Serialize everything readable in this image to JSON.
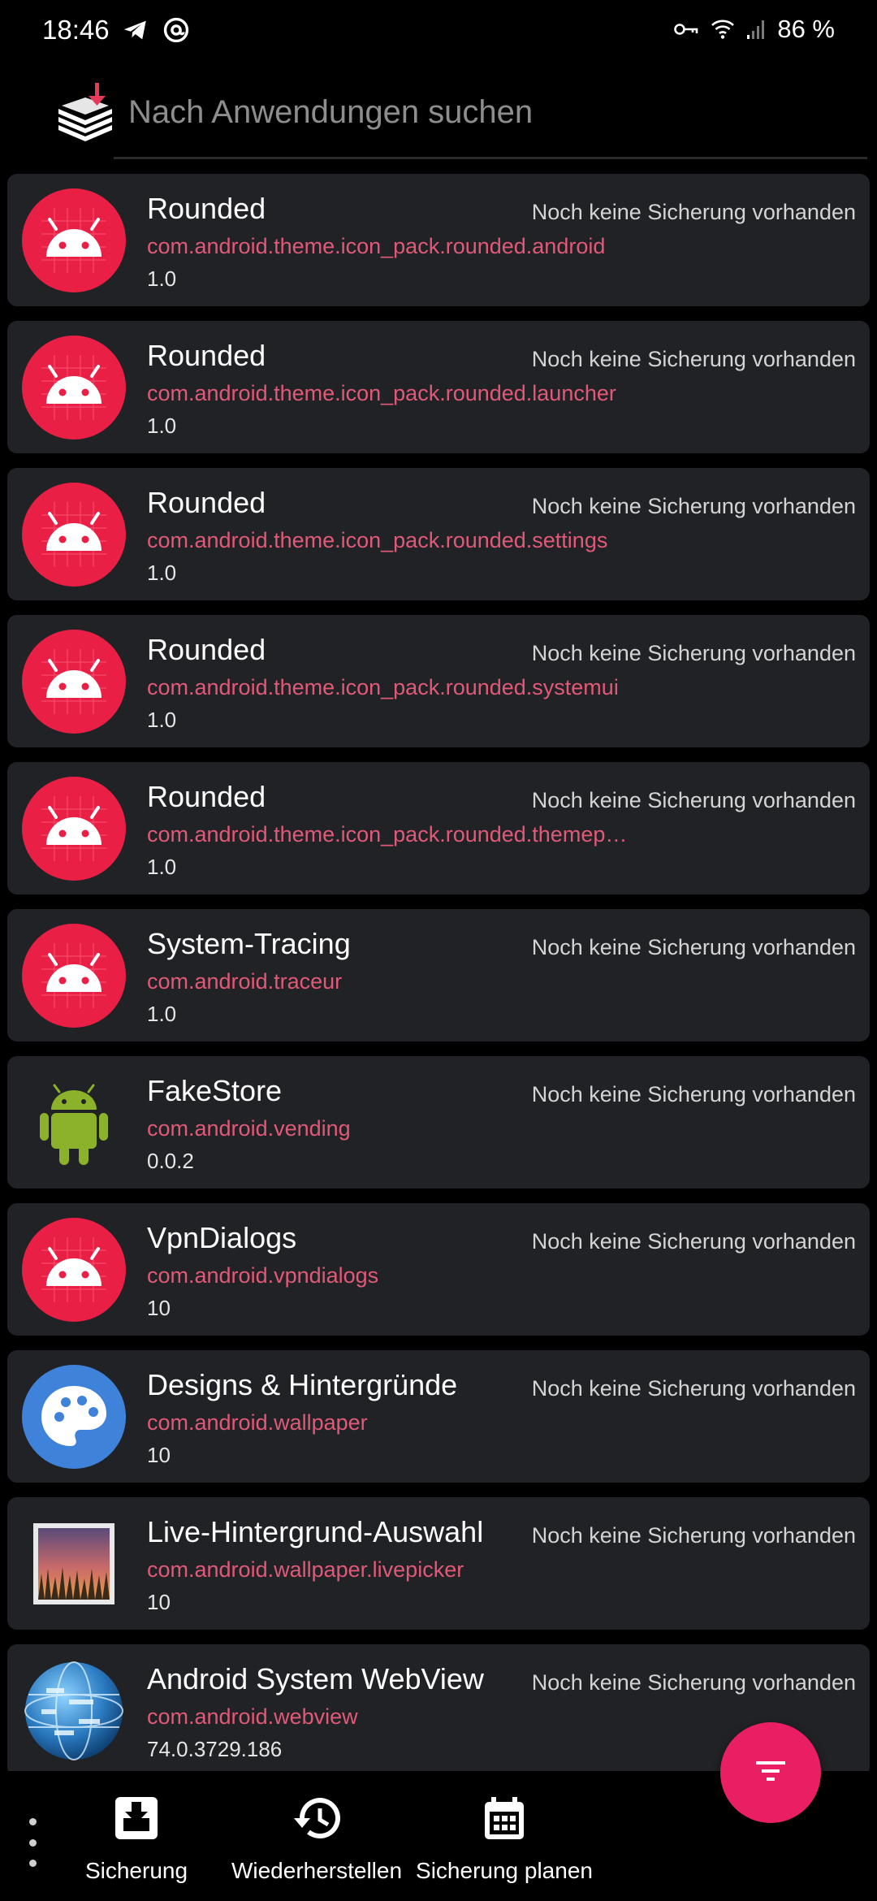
{
  "status_bar": {
    "time": "18:46",
    "left_icons": [
      "telegram-icon",
      "at-sign-icon"
    ],
    "right_icons": [
      "vpn-key-icon",
      "wifi-icon",
      "signal-icon"
    ],
    "battery": "86 %"
  },
  "search": {
    "placeholder": "Nach Anwendungen suchen",
    "value": ""
  },
  "apps": [
    {
      "name": "Rounded",
      "package": "com.android.theme.icon_pack.rounded.android",
      "version": "1.0",
      "status": "Noch keine Sicherung vorhanden",
      "icon": "android-red-icon"
    },
    {
      "name": "Rounded",
      "package": "com.android.theme.icon_pack.rounded.launcher",
      "version": "1.0",
      "status": "Noch keine Sicherung vorhanden",
      "icon": "android-red-icon"
    },
    {
      "name": "Rounded",
      "package": "com.android.theme.icon_pack.rounded.settings",
      "version": "1.0",
      "status": "Noch keine Sicherung vorhanden",
      "icon": "android-red-icon"
    },
    {
      "name": "Rounded",
      "package": "com.android.theme.icon_pack.rounded.systemui",
      "version": "1.0",
      "status": "Noch keine Sicherung vorhanden",
      "icon": "android-red-icon"
    },
    {
      "name": "Rounded",
      "package": "com.android.theme.icon_pack.rounded.themep…",
      "version": "1.0",
      "status": "Noch keine Sicherung vorhanden",
      "icon": "android-red-icon"
    },
    {
      "name": "System-Tracing",
      "package": "com.android.traceur",
      "version": "1.0",
      "status": "Noch keine Sicherung vorhanden",
      "icon": "android-red-icon"
    },
    {
      "name": "FakeStore",
      "package": "com.android.vending",
      "version": "0.0.2",
      "status": "Noch keine Sicherung vorhanden",
      "icon": "android-robot-green-icon"
    },
    {
      "name": "VpnDialogs",
      "package": "com.android.vpndialogs",
      "version": "10",
      "status": "Noch keine Sicherung vorhanden",
      "icon": "android-red-icon"
    },
    {
      "name": "Designs & Hintergründe",
      "package": "com.android.wallpaper",
      "version": "10",
      "status": "Noch keine Sicherung vorhanden",
      "icon": "palette-icon"
    },
    {
      "name": "Live-Hintergrund-Auswahl",
      "package": "com.android.wallpaper.livepicker",
      "version": "10",
      "status": "Noch keine Sicherung vorhanden",
      "icon": "wallpaper-picture-icon"
    },
    {
      "name": "Android System WebView",
      "package": "com.android.webview",
      "version": "74.0.3729.186",
      "status": "Noch keine Sicherung vorhanden",
      "icon": "webview-globe-icon"
    }
  ],
  "fab": {
    "icon": "filter-icon",
    "color": "#ea1f63"
  },
  "bottom_nav": {
    "overflow_icon": "more-vert-icon",
    "backup_label": "Sicherung",
    "restore_label": "Wiederherstellen",
    "schedule_label": "Sicherung planen"
  },
  "colors": {
    "background": "#000000",
    "card": "#212226",
    "package_text": "#e05a78",
    "accent": "#ea1f63"
  }
}
